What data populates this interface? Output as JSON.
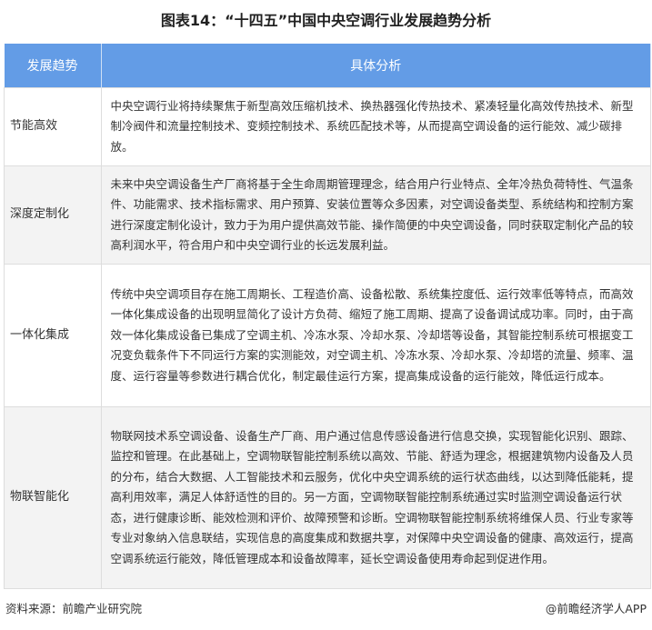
{
  "title": "图表14：“十四五”中国中央空调行业发展趋势分析",
  "table": {
    "headers": [
      "发展趋势",
      "具体分析"
    ],
    "rows": [
      {
        "trend": "节能高效",
        "analysis": "中央空调行业将持续聚焦于新型高效压缩机技术、换热器强化传热技术、紧凑轻量化高效传热技术、新型制冷阀件和流量控制技术、变频控制技术、系统匹配技术等，从而提高空调设备的运行能效、减少碳排放。"
      },
      {
        "trend": "深度定制化",
        "analysis": "未来中央空调设备生产厂商将基于全生命周期管理理念，结合用户行业特点、全年冷热负荷特性、气温条件、功能需求、技术指标需求、用户预算、安装位置等众多因素，对空调设备类型、系统结构和控制方案进行深度定制化设计，致力于为用户提供高效节能、操作简便的中央空调设备，同时获取定制化产品的较高利润水平，符合用户和中央空调行业的长远发展利益。"
      },
      {
        "trend": "一体化集成",
        "analysis": "传统中央空调项目存在施工周期长、工程造价高、设备松散、系统集控度低、运行效率低等特点，而高效一体化集成设备的出现明显简化了设计方负荷、缩短了施工周期、提高了设备调试成功率。同时，由于高效一体化集成设备已集成了空调主机、冷冻水泵、冷却水泵、冷却塔等设备，其智能控制系统可根据变工况变负载条件下不同运行方案的实测能效，对空调主机、冷冻水泵、冷却水泵、冷却塔的流量、频率、温度、运行容量等参数进行耦合优化，制定最佳运行方案，提高集成设备的运行能效，降低运行成本。"
      },
      {
        "trend": "物联智能化",
        "analysis": "物联网技术系空调设备、设备生产厂商、用户通过信息传感设备进行信息交换，实现智能化识别、跟踪、监控和管理。在此基础上，空调物联智能控制系统以高效、节能、舒适为理念，根据建筑物内设备及人员的分布，结合大数据、人工智能技术和云服务，优化中央空调系统的运行状态曲线，以达到降低能耗，提高利用效率，满足人体舒适性的目的。另一方面，空调物联智能控制系统通过实时监测空调设备运行状态，进行健康诊断、能效检测和评价、故障预警和诊断。空调物联智能控制系统将维保人员、行业专家等专业对象纳入信息联结，实现信息的高度集成和数据共享，对保障中央空调设备的健康、高效运行，提高空调系统运行能效，降低管理成本和设备故障率，延长空调设备使用寿命起到促进作用。"
      }
    ]
  },
  "footer": {
    "source": "资料来源：前瞻产业研究院",
    "credit": "@前瞻经济学人APP"
  }
}
